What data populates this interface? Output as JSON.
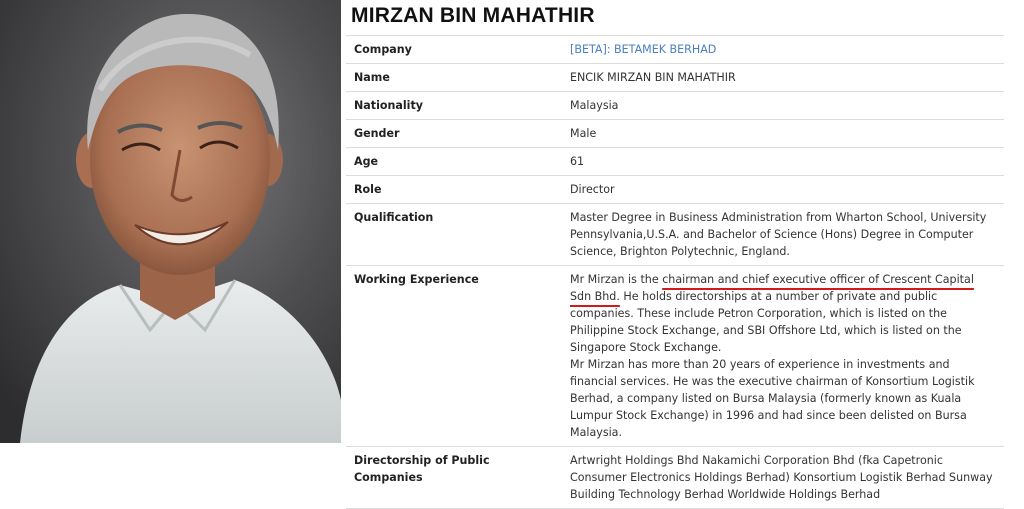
{
  "profile": {
    "name": "MIRZAN BIN MAHATHIR",
    "photo_alt": "portrait-photo"
  },
  "rows": [
    {
      "label": "Company",
      "value": "[BETA]: BETAMEK BERHAD",
      "link": true
    },
    {
      "label": "Name",
      "value": "ENCIK MIRZAN BIN MAHATHIR"
    },
    {
      "label": "Nationality",
      "value": "Malaysia"
    },
    {
      "label": "Gender",
      "value": "Male"
    },
    {
      "label": "Age",
      "value": "61"
    },
    {
      "label": "Role",
      "value": "Director"
    },
    {
      "label": "Qualification",
      "value": "Master Degree in Business Administration from Wharton School, University Pennsylvania,U.S.A. and Bachelor of Science (Hons) Degree in Computer Science, Brighton Polytechnic, England."
    }
  ],
  "working_experience": {
    "label": "Working Experience",
    "prefix": "Mr Mirzan is the ",
    "highlight": "chairman and chief executive officer of Crescent Capital Sdn Bhd.",
    "rest1": "He holds directorships at a number of private and public companies. These include Petron Corporation, which is listed on the Philippine Stock Exchange, and SBI Offshore Ltd, which is listed on the Singapore Stock Exchange.",
    "para2": "Mr Mirzan has more than 20 years of experience in investments and financial services. He was the executive chairman of Konsortium Logistik Berhad, a company listed on Bursa Malaysia (formerly known as Kuala Lumpur Stock Exchange) in 1996 and had since been delisted on Bursa Malaysia."
  },
  "directorship": {
    "label": "Directorship of Public Companies",
    "value": "Artwright Holdings Bhd Nakamichi Corporation Bhd (fka Capetronic Consumer Electronics Holdings Berhad) Konsortium Logistik Berhad Sunway Building Technology Berhad Worldwide Holdings Berhad"
  },
  "colors": {
    "link": "#4a7fc0",
    "annotation": "#d11a1a",
    "border": "#dcdcdc"
  }
}
